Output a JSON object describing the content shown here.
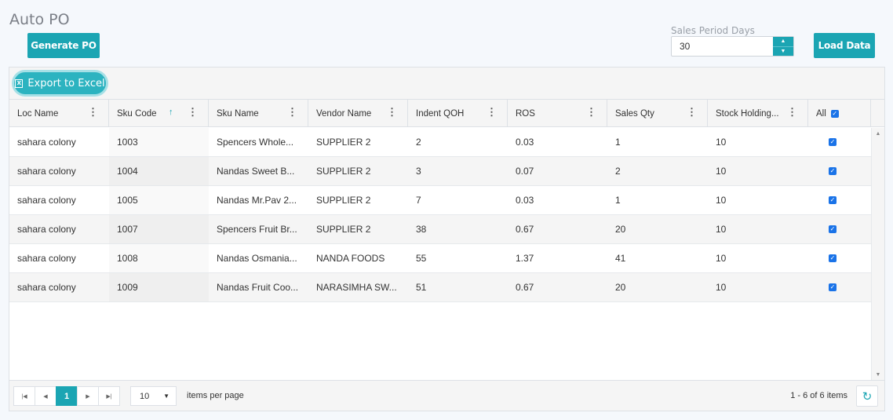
{
  "page": {
    "title": "Auto PO",
    "generate_label": "Generate PO",
    "load_label": "Load Data",
    "period_label": "Sales Period Days",
    "period_value": "30"
  },
  "toolbar": {
    "export_label": "Export to Excel",
    "export_icon": "excel-icon"
  },
  "columns": [
    {
      "label": "Loc Name"
    },
    {
      "label": "Sku Code",
      "sort": "ascending"
    },
    {
      "label": "Sku Name"
    },
    {
      "label": "Vendor Name"
    },
    {
      "label": "Indent QOH"
    },
    {
      "label": "ROS"
    },
    {
      "label": "Sales Qty"
    },
    {
      "label": "Stock Holding..."
    },
    {
      "label": "All",
      "checked": true
    }
  ],
  "rows": [
    {
      "loc": "sahara colony",
      "sku": "1003",
      "name": "Spencers Whole...",
      "vendor": "SUPPLIER 2",
      "qoh": "2",
      "ros": "0.03",
      "sales": "1",
      "stock": "10",
      "checked": true
    },
    {
      "loc": "sahara colony",
      "sku": "1004",
      "name": "Nandas Sweet B...",
      "vendor": "SUPPLIER 2",
      "qoh": "3",
      "ros": "0.07",
      "sales": "2",
      "stock": "10",
      "checked": true
    },
    {
      "loc": "sahara colony",
      "sku": "1005",
      "name": "Nandas Mr.Pav 2...",
      "vendor": "SUPPLIER 2",
      "qoh": "7",
      "ros": "0.03",
      "sales": "1",
      "stock": "10",
      "checked": true
    },
    {
      "loc": "sahara colony",
      "sku": "1007",
      "name": "Spencers Fruit Br...",
      "vendor": "SUPPLIER 2",
      "qoh": "38",
      "ros": "0.67",
      "sales": "20",
      "stock": "10",
      "checked": true
    },
    {
      "loc": "sahara colony",
      "sku": "1008",
      "name": "Nandas Osmania...",
      "vendor": "NANDA FOODS",
      "qoh": "55",
      "ros": "1.37",
      "sales": "41",
      "stock": "10",
      "checked": true
    },
    {
      "loc": "sahara colony",
      "sku": "1009",
      "name": "Nandas Fruit Coo...",
      "vendor": "NARASIMHA SW...",
      "qoh": "51",
      "ros": "0.67",
      "sales": "20",
      "stock": "10",
      "checked": true
    }
  ],
  "pager": {
    "current_page": "1",
    "page_size": "10",
    "items_per_page_label": "items per page",
    "count_text": "1 - 6 of 6 items"
  },
  "colors": {
    "accent": "#1ba5b3",
    "checkbox": "#1a73e8"
  }
}
